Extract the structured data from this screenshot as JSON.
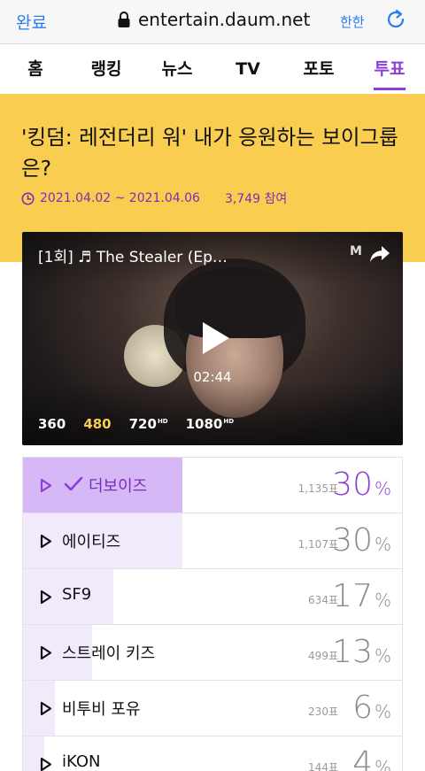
{
  "browser": {
    "done_label": "완료",
    "url": "entertain.daum.net",
    "translate_label": "한한"
  },
  "nav": {
    "tabs": [
      {
        "label": "홈",
        "active": false
      },
      {
        "label": "랭킹",
        "active": false
      },
      {
        "label": "뉴스",
        "active": false
      },
      {
        "label": "TV",
        "active": false
      },
      {
        "label": "포토",
        "active": false
      },
      {
        "label": "투표",
        "active": true
      }
    ]
  },
  "poll": {
    "title": "'킹덤: 레전더리 워' 내가 응원하는 보이그룹은?",
    "period": "2021.04.02 ~ 2021.04.06",
    "participants": "3,749 참여"
  },
  "video": {
    "title": "[1회] ♬ The Stealer (Ep…",
    "logo_text": "M",
    "duration": "02:44",
    "qualities": [
      {
        "label": "360",
        "hd": "",
        "selected": false
      },
      {
        "label": "480",
        "hd": "",
        "selected": true
      },
      {
        "label": "720",
        "hd": "HD",
        "selected": false
      },
      {
        "label": "1080",
        "hd": "HD",
        "selected": false
      }
    ]
  },
  "options": [
    {
      "name": "더보이즈",
      "votes": "1,135표",
      "percent": "30",
      "percent_sign": "%",
      "voted": true,
      "fill": 0.3
    },
    {
      "name": "에이티즈",
      "votes": "1,107표",
      "percent": "30",
      "percent_sign": "%",
      "voted": false,
      "fill": 0.3
    },
    {
      "name": "SF9",
      "votes": "634표",
      "percent": "17",
      "percent_sign": "%",
      "voted": false,
      "fill": 0.17
    },
    {
      "name": "스트레이 키즈",
      "votes": "499표",
      "percent": "13",
      "percent_sign": "%",
      "voted": false,
      "fill": 0.13
    },
    {
      "name": "비투비 포유",
      "votes": "230표",
      "percent": "6",
      "percent_sign": "%",
      "voted": false,
      "fill": 0.06
    },
    {
      "name": "iKON",
      "votes": "144표",
      "percent": "4",
      "percent_sign": "%",
      "voted": false,
      "fill": 0.04
    }
  ],
  "colors": {
    "accent": "#8a3fd6",
    "header_bg": "#f8cd50",
    "browser_blue": "#2b7cf0",
    "bar_fill": "#f1eafb",
    "bar_fill_voted": "#d6b8f7"
  }
}
